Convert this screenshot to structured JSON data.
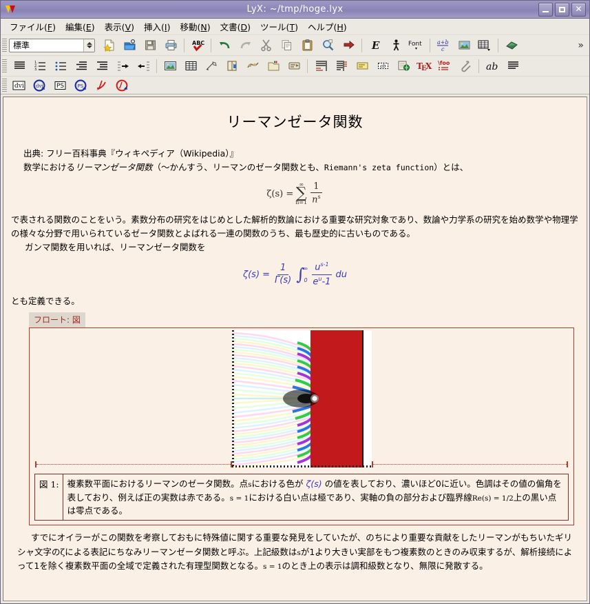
{
  "window": {
    "title": "LyX: ~/tmp/hoge.lyx",
    "logo_name": "lyx-logo",
    "buttons": {
      "minimize": "minimize",
      "maximize": "maximize",
      "close": "close"
    }
  },
  "menubar": {
    "items": [
      {
        "label": "ファイル(F)",
        "pre": "ファイル(",
        "key": "F",
        "post": ")",
        "name": "menu-file"
      },
      {
        "label": "編集(E)",
        "pre": "編集(",
        "key": "E",
        "post": ")",
        "name": "menu-edit"
      },
      {
        "label": "表示(V)",
        "pre": "表示(",
        "key": "V",
        "post": ")",
        "name": "menu-view"
      },
      {
        "label": "挿入(I)",
        "pre": "挿入(",
        "key": "I",
        "post": ")",
        "name": "menu-insert"
      },
      {
        "label": "移動(N)",
        "pre": "移動(",
        "key": "N",
        "post": ")",
        "name": "menu-navigate"
      },
      {
        "label": "文書(D)",
        "pre": "文書(",
        "key": "D",
        "post": ")",
        "name": "menu-document"
      },
      {
        "label": "ツール(T)",
        "pre": "ツール(",
        "key": "T",
        "post": ")",
        "name": "menu-tools"
      },
      {
        "label": "ヘルプ(H)",
        "pre": "ヘルプ(",
        "key": "H",
        "post": ")",
        "name": "menu-help"
      }
    ]
  },
  "toolbar_standard": {
    "style_combo": {
      "value": "標準",
      "name": "paragraph-style-combo"
    },
    "overflow_label": "»",
    "items": [
      "new-document-icon",
      "open-document-icon",
      "save-document-icon",
      "print-icon",
      "spellcheck-icon",
      "undo-icon",
      "redo-icon",
      "cut-icon",
      "copy-icon",
      "paste-icon",
      "find-replace-icon",
      "track-changes-icon",
      "emphasis-icon",
      "noun-icon",
      "font-icon",
      "math-inline-icon",
      "insert-graphics-icon",
      "insert-table-icon",
      "thesaurus-icon"
    ]
  },
  "toolbar_extra": {
    "items": [
      "numbered-list-icon",
      "enumerate-icon",
      "itemize-icon",
      "description-icon",
      "indent-icon",
      "increase-depth-icon",
      "decrease-depth-icon",
      "insert-graphics-icon",
      "insert-table-icon",
      "insert-math-icon",
      "insert-citation-icon",
      "insert-index-icon",
      "insert-file-icon",
      "insert-label-icon",
      "insert-footnote-icon",
      "insert-marginnote-icon",
      "insert-note-icon",
      "insert-box-icon",
      "insert-url-icon",
      "tex-mode-icon",
      "insert-macro-icon",
      "attach-file-icon",
      "text-style-icon",
      "paragraph-settings-icon"
    ]
  },
  "toolbar_export": {
    "items": [
      {
        "name": "view-dvi-icon",
        "label": "dvi"
      },
      {
        "name": "update-dvi-icon",
        "label": "dvi"
      },
      {
        "name": "view-ps-icon",
        "label": "PS"
      },
      {
        "name": "update-ps-icon",
        "label": "PS"
      },
      {
        "name": "view-pdf-icon",
        "label": "PDF"
      },
      {
        "name": "update-pdf-icon",
        "label": "PDF"
      }
    ]
  },
  "document": {
    "title": "リーマンゼータ関数",
    "source_line": "出典: フリー百科事典『ウィキペディア（Wikipedia）』",
    "intro_pre": "数学における",
    "intro_italic": "リーマンゼータ関数",
    "intro_mid": "（〜かんすう、リーマンのゼータ関数とも、",
    "intro_mono": "Riemann's zeta function",
    "intro_post": "）とは、",
    "formula1": {
      "name": "zeta-series-formula",
      "lhs": "ζ(s) =",
      "sum_upper": "∞",
      "sum_symbol": "∑",
      "sum_lower": "n=1",
      "numerator": "1",
      "denominator_base": "n",
      "denominator_exp": "s"
    },
    "body1": "で表される関数のことをいう。素数分布の研究をはじめとした解析的数論における重要な研究対象であり、数論や力学系の研究を始め数学や物理学の様々な分野で用いられているゼータ関数とよばれる一連の関数のうち、最も歴史的に古いものである。",
    "body2": "ガンマ関数を用いれば、リーマンゼータ関数を",
    "formula2": {
      "name": "zeta-gamma-integral-formula",
      "lhs": "ζ(s) =",
      "frac_num": "1",
      "frac_den": "Γ(s)",
      "int_upper": "∞",
      "int_lower": "0",
      "int_symbol": "∫",
      "inner_num_base": "u",
      "inner_num_exp": "s-1",
      "inner_den": "e",
      "inner_den_exp": "u",
      "inner_den_tail": "-1",
      "tail": "du"
    },
    "body3": "とも定義できる。",
    "float": {
      "label": "フロート: 図",
      "label_name": "float-label-figure",
      "image_name": "riemann-zeta-domain-coloring-image",
      "caption_number": "図 1:",
      "caption_part1": "複素数平面におけるリーマンのゼータ関数。点",
      "caption_s1": "s",
      "caption_part2": "における色が ",
      "caption_zeta": "ζ(s)",
      "caption_part3": " の値を表しており、濃いほど0に近い。色調はその値の偏角を表しており、例えば正の実数は赤である。",
      "caption_s2": "s = 1",
      "caption_part4": "における白い点は極であり、実軸の負の部分および臨界線",
      "caption_re": "Re(s) = 1/2",
      "caption_part5": "上の黒い点は零点である。"
    },
    "tail_paragraph_1": "すでにオイラーがこの関数を考察しておもに特殊値に関する重要な発見をしていたが、のちにより重要な貢献をしたリーマンがもちいたギリシャ文字の",
    "tail_zeta": "ζ",
    "tail_paragraph_2": "による表記にちなみリーマンゼータ関数と呼ぶ。上記級数は",
    "tail_s1": "s",
    "tail_paragraph_3": "が1より大きい実部をもつ複素数のときのみ収束するが、解析接続によって1を除く複素数平面の全域で定義された有理型関数となる。",
    "tail_s2": "s = 1",
    "tail_paragraph_4": "のとき上の表示は調和級数となり、無限に発散する。"
  },
  "colors": {
    "titlebar": "#8f89bb",
    "toolbar_bg": "#ece9e2",
    "document_bg": "#fbf0e5",
    "float_border": "#b33a2c",
    "float_label_text": "#a02a22",
    "math_blue": "#3b3bb5",
    "zeta_red": "#c2191c"
  }
}
